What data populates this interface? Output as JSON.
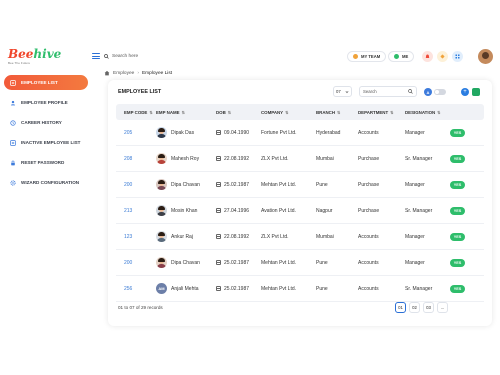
{
  "brand": {
    "part1": "Bee",
    "part2": "hive",
    "tagline": "Bee The Future"
  },
  "header": {
    "search_label": "Search here",
    "my_team": "MY TEAM",
    "me": "ME"
  },
  "sidebar": {
    "items": [
      {
        "label": "EMPLOYEE LIST",
        "icon": "list-icon",
        "active": true
      },
      {
        "label": "EMPLOYEE PROFILE",
        "icon": "user-icon",
        "active": false
      },
      {
        "label": "CAREER HISTORY",
        "icon": "history-icon",
        "active": false
      },
      {
        "label": "INACTIVE EMPLOYEE LIST",
        "icon": "list-icon",
        "active": false
      },
      {
        "label": "RESET PASSWORD",
        "icon": "lock-icon",
        "active": false
      },
      {
        "label": "WIZARD CONFIGURATION",
        "icon": "settings-icon",
        "active": false
      }
    ]
  },
  "breadcrumb": {
    "root": "Employee",
    "current": "Employee List"
  },
  "card": {
    "title": "EMPLOYEE LIST",
    "per_page": "07",
    "search_placeholder": "Search",
    "filter_badge": "A"
  },
  "table": {
    "headers": {
      "code": "EMP CODE",
      "name": "EMP NAME",
      "dob": "DOB",
      "company": "COMPANY",
      "branch": "BRANCH",
      "department": "DEPARTMENT",
      "designation": "DESIGNATION"
    },
    "rows": [
      {
        "code": "205",
        "name": "Dipak Das",
        "dob": "09.04.1990",
        "company": "Fortune Pvt Ltd.",
        "branch": "Hyderabad",
        "department": "Accounts",
        "designation": "Manager",
        "status": "YES"
      },
      {
        "code": "208",
        "name": "Mahesh Roy",
        "dob": "22.08.1992",
        "company": "ZLX Pvt Ltd.",
        "branch": "Mumbai",
        "department": "Purchase",
        "designation": "Sr. Manager",
        "status": "YES"
      },
      {
        "code": "200",
        "name": "Dipa Chavan",
        "dob": "25.02.1987",
        "company": "Mehtan Pvt Ltd.",
        "branch": "Pune",
        "department": "Purchase",
        "designation": "Manager",
        "status": "YES"
      },
      {
        "code": "213",
        "name": "Mosin Khan",
        "dob": "27.04.1996",
        "company": "Avation Pvt Ltd.",
        "branch": "Nagpur",
        "department": "Purchase",
        "designation": "Sr. Manager",
        "status": "YES"
      },
      {
        "code": "123",
        "name": "Ankur Raj",
        "dob": "22.08.1992",
        "company": "ZLX Pvt Ltd.",
        "branch": "Mumbai",
        "department": "Accounts",
        "designation": "Manager",
        "status": "YES"
      },
      {
        "code": "200",
        "name": "Dipa Chavan",
        "dob": "25.02.1987",
        "company": "Mehtan Pvt Ltd.",
        "branch": "Pune",
        "department": "Accounts",
        "designation": "Manager",
        "status": "YES"
      },
      {
        "code": "256",
        "name": "Anjali Mehta",
        "dob": "25.02.1987",
        "company": "Mehtan Pvt Ltd.",
        "branch": "Pune",
        "department": "Accounts",
        "designation": "Sr. Manager",
        "status": "YES",
        "initials": "AM"
      }
    ]
  },
  "footer": {
    "records": "01 to 07 of 29 records",
    "pages": [
      "01",
      "02",
      "03"
    ],
    "more": "..."
  },
  "colors": {
    "accent": "#f25a3a",
    "link": "#3a7bd5",
    "status_yes": "#2ebd6b"
  }
}
